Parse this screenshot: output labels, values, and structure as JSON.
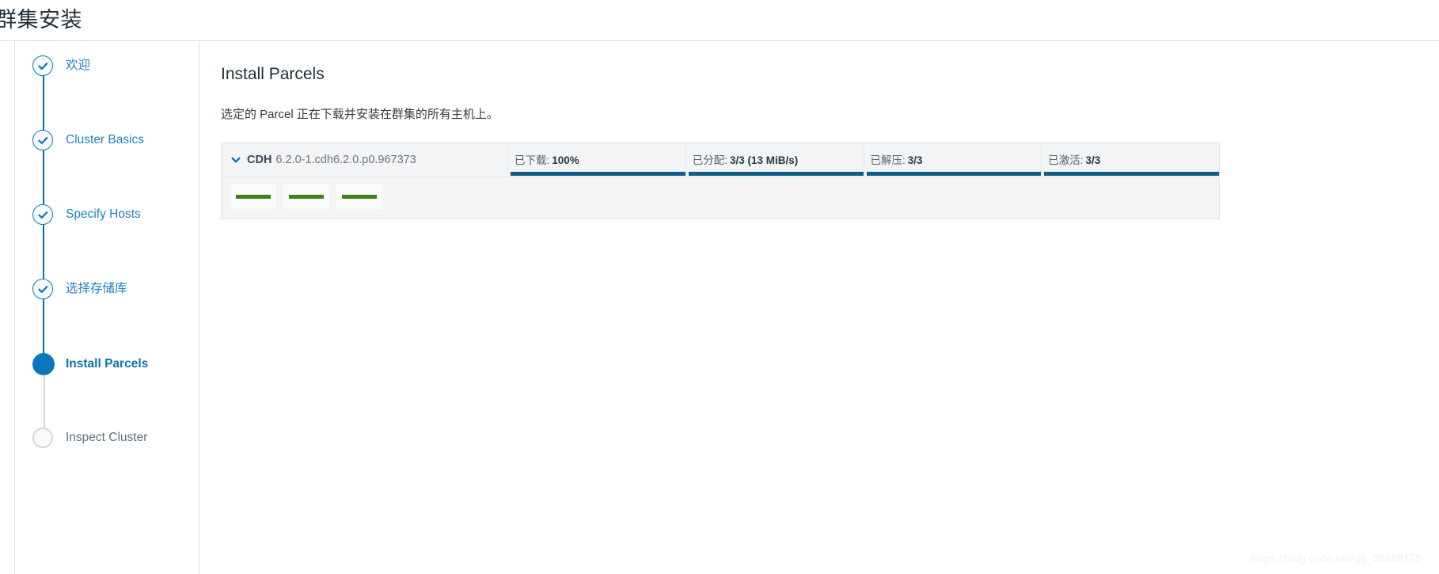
{
  "header": {
    "title": "群集安装"
  },
  "sidebar": {
    "steps": [
      {
        "label": "欢迎",
        "state": "done",
        "icon": "check-icon"
      },
      {
        "label": "Cluster Basics",
        "state": "done",
        "icon": "check-icon"
      },
      {
        "label": "Specify Hosts",
        "state": "done",
        "icon": "check-icon"
      },
      {
        "label": "选择存储库",
        "state": "done",
        "icon": "check-icon"
      },
      {
        "label": "Install Parcels",
        "state": "current",
        "icon": "filled-dot-icon"
      },
      {
        "label": "Inspect Cluster",
        "state": "pending",
        "icon": "empty-circle-icon"
      }
    ]
  },
  "main": {
    "heading": "Install Parcels",
    "subtitle": "选定的 Parcel 正在下载并安装在群集的所有主机上。",
    "parcel": {
      "expand_icon": "chevron-down-icon",
      "name": "CDH",
      "version": "6.2.0-1.cdh6.2.0.p0.967373",
      "progress": [
        {
          "label": "已下载:",
          "value": "100%",
          "percent": 100
        },
        {
          "label": "已分配:",
          "value": "3/3 (13 MiB/s)",
          "percent": 100
        },
        {
          "label": "已解压:",
          "value": "3/3",
          "percent": 100
        },
        {
          "label": "已激活:",
          "value": "3/3",
          "percent": 100
        }
      ],
      "hosts": [
        {
          "percent": 100
        },
        {
          "percent": 100
        },
        {
          "percent": 100
        }
      ]
    }
  },
  "watermark": {
    "text": "https://blog.csdn.net/qq_36488175"
  },
  "colors": {
    "accent_blue": "#1f7fc4",
    "progress_blue": "#145b8c",
    "host_green": "#3d8211",
    "panel_bg": "#f2f4f6"
  }
}
